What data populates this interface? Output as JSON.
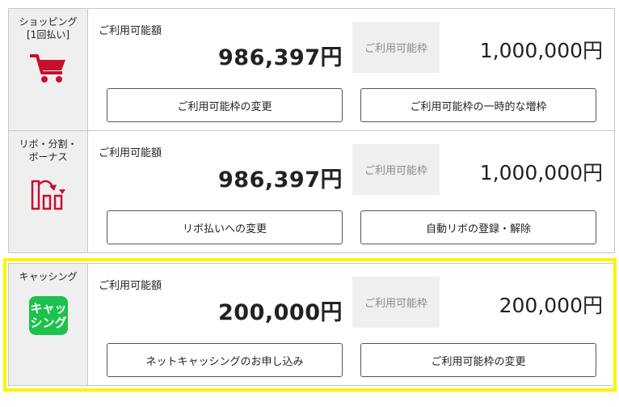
{
  "sections": [
    {
      "label_lines": [
        "ショッピング",
        "[1回払い]"
      ],
      "icon": "shopping-cart-icon",
      "available_label": "ご利用可能額",
      "available_amount": "986,397円",
      "limit_label": "ご利用可能枠",
      "limit_amount": "1,000,000円",
      "buttons": [
        "ご利用可能枠の変更",
        "ご利用可能枠の一時的な増枠"
      ]
    },
    {
      "label_lines": [
        "リボ・分割・",
        "ボーナス"
      ],
      "icon": "revolving-payment-icon",
      "available_label": "ご利用可能額",
      "available_amount": "986,397円",
      "limit_label": "ご利用可能枠",
      "limit_amount": "1,000,000円",
      "buttons": [
        "リボ払いへの変更",
        "自動リボの登録・解除"
      ]
    },
    {
      "label_lines": [
        "キャッシング"
      ],
      "icon": "cashing-icon",
      "icon_text": [
        "キャッ",
        "シング"
      ],
      "available_label": "ご利用可能額",
      "available_amount": "200,000円",
      "limit_label": "ご利用可能枠",
      "limit_amount": "200,000円",
      "buttons": [
        "ネットキャッシングのお申し込み",
        "ご利用可能枠の変更"
      ]
    }
  ],
  "colors": {
    "icon_red": "#c8102e",
    "cashing_green": "#1cc24b",
    "highlight_yellow": "#fff200",
    "label_bg": "#efefef",
    "limit_box_bg": "#f0efed"
  }
}
